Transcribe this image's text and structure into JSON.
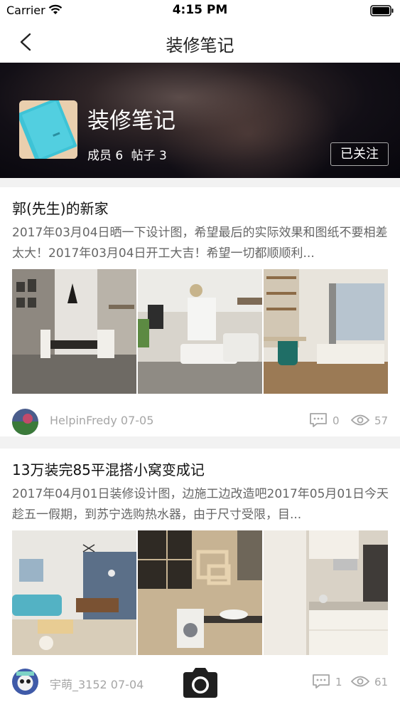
{
  "status_bar": {
    "carrier": "Carrier",
    "time": "4:15 PM"
  },
  "nav": {
    "title": "装修笔记",
    "back_icon": "chevron-left-icon"
  },
  "group": {
    "name": "装修笔记",
    "members_label": "成员 6",
    "posts_label": "帖子 3",
    "follow_label": "已关注"
  },
  "posts": [
    {
      "title": "郭(先生)的新家",
      "excerpt": "2017年03月04日晒一下设计图，希望最后的实际效果和图纸不要相差太大！2017年03月04日开工大吉！希望一切都顺顺利...",
      "author_line": "HelpinFredy 07-05",
      "comments": "0",
      "views": "57"
    },
    {
      "title": "13万装完85平混搭小窝变成记",
      "excerpt": "2017年04月01日装修设计图，边施工边改造吧2017年05月01日今天趁五一假期，到苏宁选购热水器，由于尺寸受限，目...",
      "author_line": "宇萌_3152 07-04",
      "comments": "1",
      "views": "61"
    }
  ],
  "colors": {
    "accent_text": "#222222",
    "muted_text": "#a6a6a6",
    "header_bg": "#120f16"
  }
}
